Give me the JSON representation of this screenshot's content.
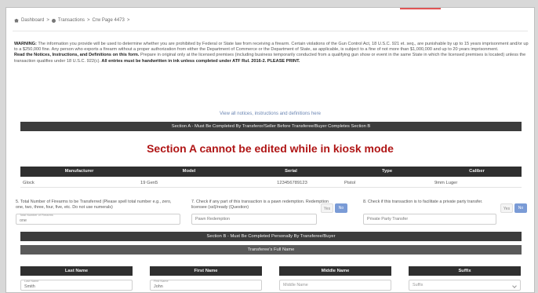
{
  "breadcrumb": {
    "dashboard": "Dashboard",
    "transactions": "Transactions",
    "page": "Crw Page 4473"
  },
  "warning": {
    "lead": "WARNING:",
    "text": " The information you provide will be used to determine whether you are prohibited by Federal or State law from receiving a firearm. Certain violations of the Gun Control Act, 18 U.S.C. 921 et. seq., are punishable by up to 15 years imprisonment and/or up to a $250,000 fine. Any person who exports a firearm without a proper authorization from either the Department of Commerce or the Department of State, as applicable, is subject to a fine of not more than $1,000,000 and up to 20 years imprisonment.",
    "read_lead": "Read the Notices, Instructions, and Definitions on this form.",
    "read_text": " Prepare in original only at the licensed premises (including business temporarily conducted from a qualifying gun show or event in the same State in which the licensed premises is located) unless the transaction qualifies under 18 U.S.C. 922(c).",
    "read_bold": " All entries must be handwritten in ink unless completed under ATF Rul. 2016-2. PLEASE PRINT."
  },
  "instructions_link": "View all notices, instructions and definitions here",
  "section_a_bar": "Section A - Must Be Completed By Transferor/Seller Before Transferee/Buyer Completes Section B",
  "kiosk_message": "Section A cannot be edited while in kiosk mode",
  "firearm_table": {
    "headers": [
      "Manufacturer",
      "Model",
      "Serial",
      "Type",
      "Caliber"
    ],
    "row": [
      "Glock",
      "19 Gen5",
      "123456789123",
      "Pistol",
      "9mm Luger"
    ]
  },
  "q1": {
    "text": "5. Total Number of Firearms to be Transferred (Please spell total number e.g., zero, one, two, three, four, five, etc. Do not use numerals)",
    "label": "Total Number of Firearms",
    "value": "one"
  },
  "q2": {
    "text": "7. Check if any part of this transaction is a pawn redemption. Redemption licensee (ssl)/ready (Question)",
    "placeholder": "Pawn Redemption",
    "yes": "Yes",
    "no": "No"
  },
  "q3": {
    "text": "8. Check if this transaction is to facilitate a private party transfer.",
    "placeholder": "Private Party Transfer",
    "yes": "Yes",
    "no": "No"
  },
  "section_b_bar": "Section B - Must Be Completed Personally By Transferee/Buyer",
  "name_bar": "Transferee's Full Name",
  "name_fields": [
    {
      "head": "Last Name",
      "label": "Last Name",
      "value": "Smith",
      "placeholder": ""
    },
    {
      "head": "First Name",
      "label": "First Name",
      "value": "John",
      "placeholder": ""
    },
    {
      "head": "Middle Name",
      "label": "",
      "value": "",
      "placeholder": "Middle Name"
    },
    {
      "head": "Suffix",
      "label": "",
      "value": "",
      "placeholder": "Suffix"
    }
  ],
  "colors": {
    "accent": "#e05555",
    "error": "#b01616",
    "dark_bar": "#3c3c3c",
    "link": "#6b86b3",
    "toggle_active": "#7a9bd6"
  }
}
